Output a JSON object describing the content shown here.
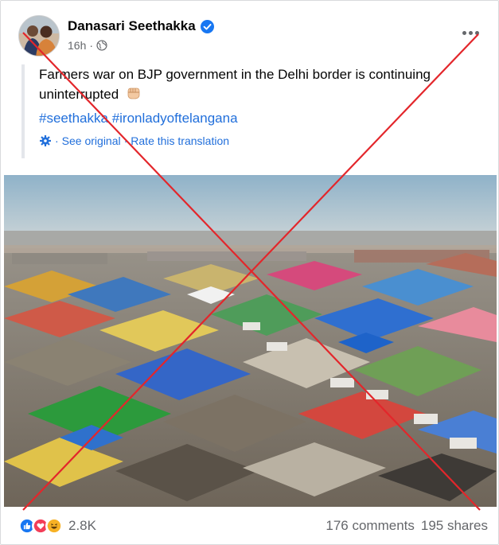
{
  "post": {
    "author": "Danasari Seethakka",
    "time": "16h",
    "text": "Farmers war on BJP government in the Delhi border is continuing uninterrupted",
    "hashtags": [
      "#seethakka",
      "#ironladyoftelangana"
    ],
    "see_original": "See original",
    "rate_translation": "Rate this translation",
    "separator": "·"
  },
  "footer": {
    "reaction_count": "2.8K",
    "comments": "176 comments",
    "shares": "195 shares"
  },
  "colors": {
    "link": "#216fdb",
    "cross": "#e3262b",
    "secondary_text": "#65676b"
  }
}
